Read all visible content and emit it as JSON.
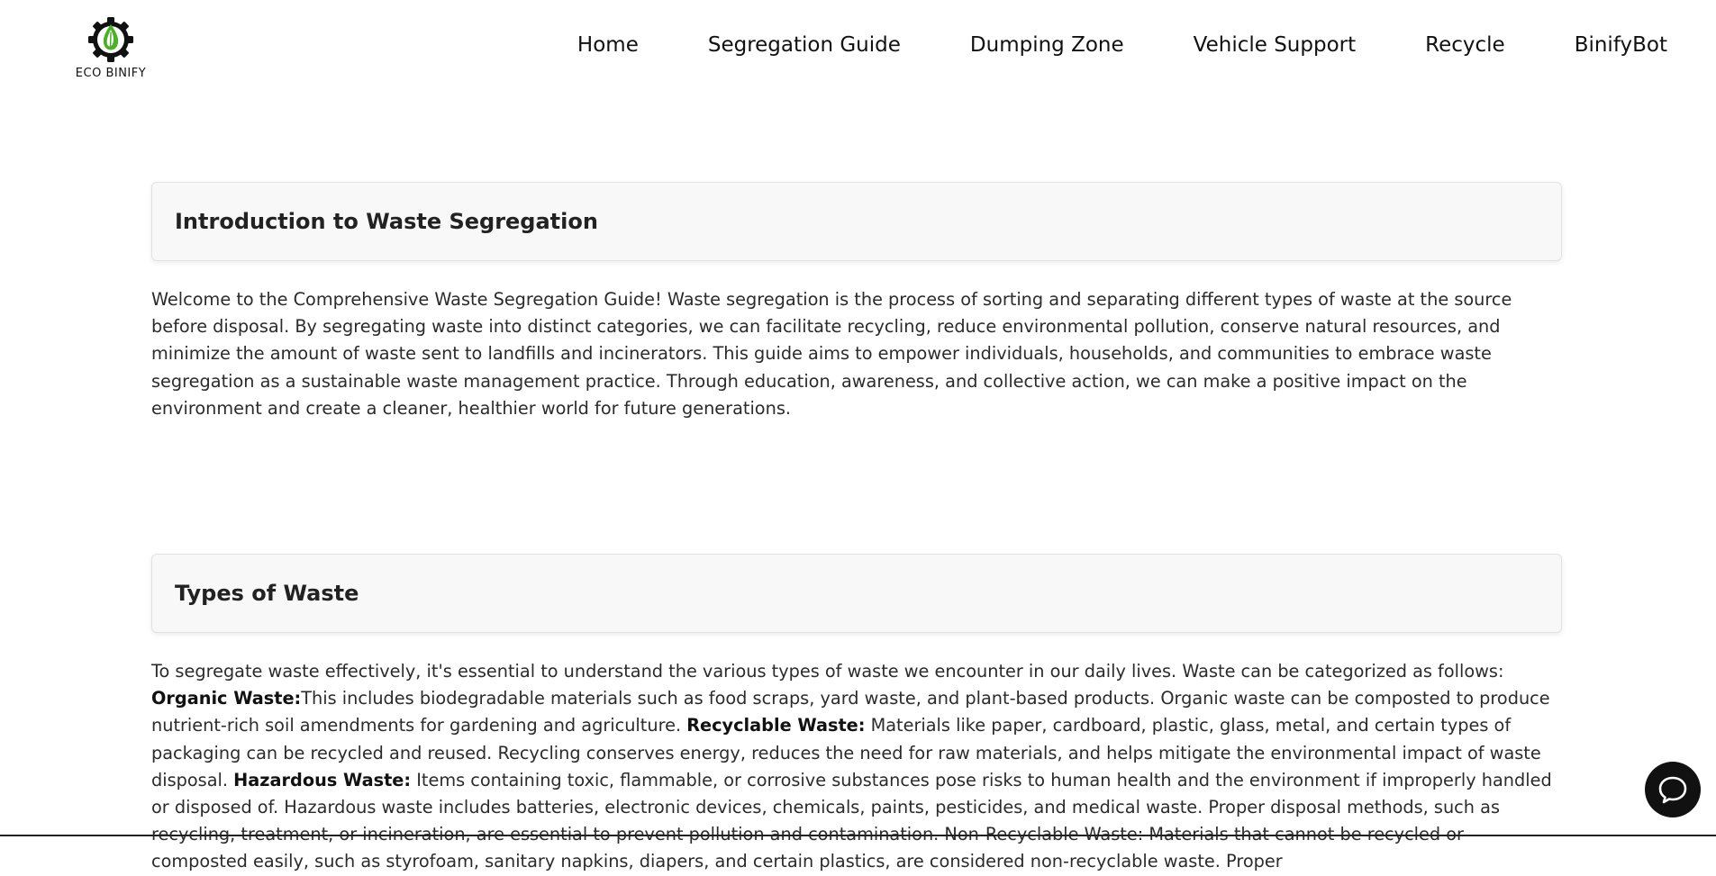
{
  "brand": {
    "name": "ECO BINIFY",
    "icon": "leaf-gear-logo",
    "colors": {
      "leaf": "#4caf2a",
      "gear": "#111111"
    }
  },
  "nav": {
    "items": [
      {
        "label": "Home"
      },
      {
        "label": "Segregation Guide"
      },
      {
        "label": "Dumping Zone"
      },
      {
        "label": "Vehicle Support"
      },
      {
        "label": "Recycle"
      },
      {
        "label": "BinifyBot"
      }
    ]
  },
  "sections": [
    {
      "title": "Introduction to Waste Segregation",
      "body": "Welcome to the Comprehensive Waste Segregation Guide! Waste segregation is the process of sorting and separating different types of waste at the source before disposal. By segregating waste into distinct categories, we can facilitate recycling, reduce environmental pollution, conserve natural resources, and minimize the amount of waste sent to landfills and incinerators. This guide aims to empower individuals, households, and communities to embrace waste segregation as a sustainable waste management practice. Through education, awareness, and collective action, we can make a positive impact on the environment and create a cleaner, healthier world for future generations."
    },
    {
      "title": "Types of Waste",
      "intro": "To segregate waste effectively, it's essential to understand the various types of waste we encounter in our daily lives. Waste can be categorized as follows: ",
      "organic_label": "Organic Waste:",
      "organic_text": "This includes biodegradable materials such as food scraps, yard waste, and plant-based products. Organic waste can be composted to produce nutrient-rich soil amendments for gardening and agriculture. ",
      "recyclable_label": "Recyclable Waste:",
      "recyclable_text": " Materials like paper, cardboard, plastic, glass, metal, and certain types of packaging can be recycled and reused. Recycling conserves energy, reduces the need for raw materials, and helps mitigate the environmental impact of waste disposal. ",
      "hazardous_label": "Hazardous Waste:",
      "hazardous_text": " Items containing toxic, flammable, or corrosive substances pose risks to human health and the environment if improperly handled or disposed of. Hazardous waste includes batteries, electronic devices, chemicals, paints, pesticides, and medical waste. Proper disposal methods, such as recycling, treatment, or incineration, are essential to prevent pollution and contamination. Non-Recyclable Waste: Materials that cannot be recycled or composted easily, such as styrofoam, sanitary napkins, diapers, and certain plastics, are considered non-recyclable waste. Proper"
    }
  ],
  "chat": {
    "icon": "chat-bubble-icon"
  }
}
